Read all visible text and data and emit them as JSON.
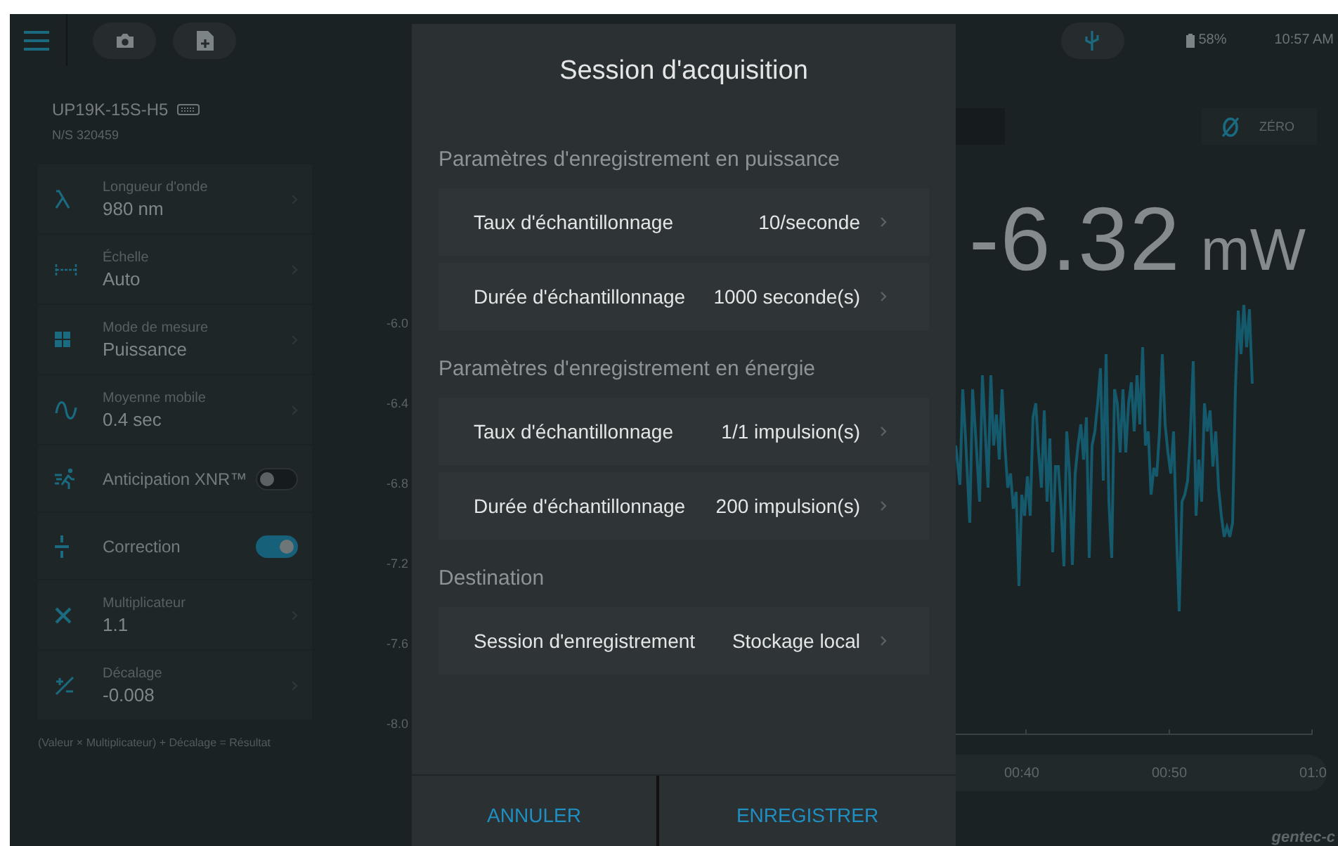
{
  "top_bar": {
    "battery": "58%",
    "time": "10:57 AM"
  },
  "device": {
    "model": "UP19K-15S-H5",
    "serial": "N/S 320459"
  },
  "settings": [
    {
      "kind": "value",
      "label": "Longueur d'onde",
      "value": "980 nm"
    },
    {
      "kind": "value",
      "label": "Échelle",
      "value": "Auto"
    },
    {
      "kind": "value",
      "label": "Mode de mesure",
      "value": "Puissance"
    },
    {
      "kind": "value",
      "label": "Moyenne mobile",
      "value": "0.4 sec"
    },
    {
      "kind": "toggle",
      "label": "Anticipation XNR™",
      "on": false
    },
    {
      "kind": "toggle",
      "label": "Correction",
      "on": true
    },
    {
      "kind": "value",
      "label": "Multiplicateur",
      "value": "1.1"
    },
    {
      "kind": "value",
      "label": "Décalage",
      "value": "-0.008"
    }
  ],
  "formula": "(Valeur × Multiplicateur) + Décalage = Résultat",
  "zero_button": {
    "label": "ZÉRO"
  },
  "reading": {
    "value": "-6.32",
    "unit": "mW"
  },
  "chart": {
    "y_ticks": [
      "-6.0",
      "-6.4",
      "-6.8",
      "-7.2",
      "-7.6",
      "-8.0"
    ],
    "x_ticks": [
      "00:40",
      "00:50",
      "01:0"
    ]
  },
  "logo": "gentec-c",
  "dialog": {
    "title": "Session d'acquisition",
    "sections": [
      {
        "title": "Paramètres d'enregistrement en puissance",
        "rows": [
          {
            "label": "Taux d'échantillonnage",
            "value": "10/seconde"
          },
          {
            "label": "Durée d'échantillonnage",
            "value": "1000 seconde(s)"
          }
        ]
      },
      {
        "title": "Paramètres d'enregistrement en énergie",
        "rows": [
          {
            "label": "Taux d'échantillonnage",
            "value": "1/1 impulsion(s)"
          },
          {
            "label": "Durée d'échantillonnage",
            "value": "200 impulsion(s)"
          }
        ]
      },
      {
        "title": "Destination",
        "rows": [
          {
            "label": "Session d'enregistrement",
            "value": "Stockage local"
          }
        ]
      }
    ],
    "buttons": [
      "ANNULER",
      "ENREGISTRER"
    ]
  }
}
